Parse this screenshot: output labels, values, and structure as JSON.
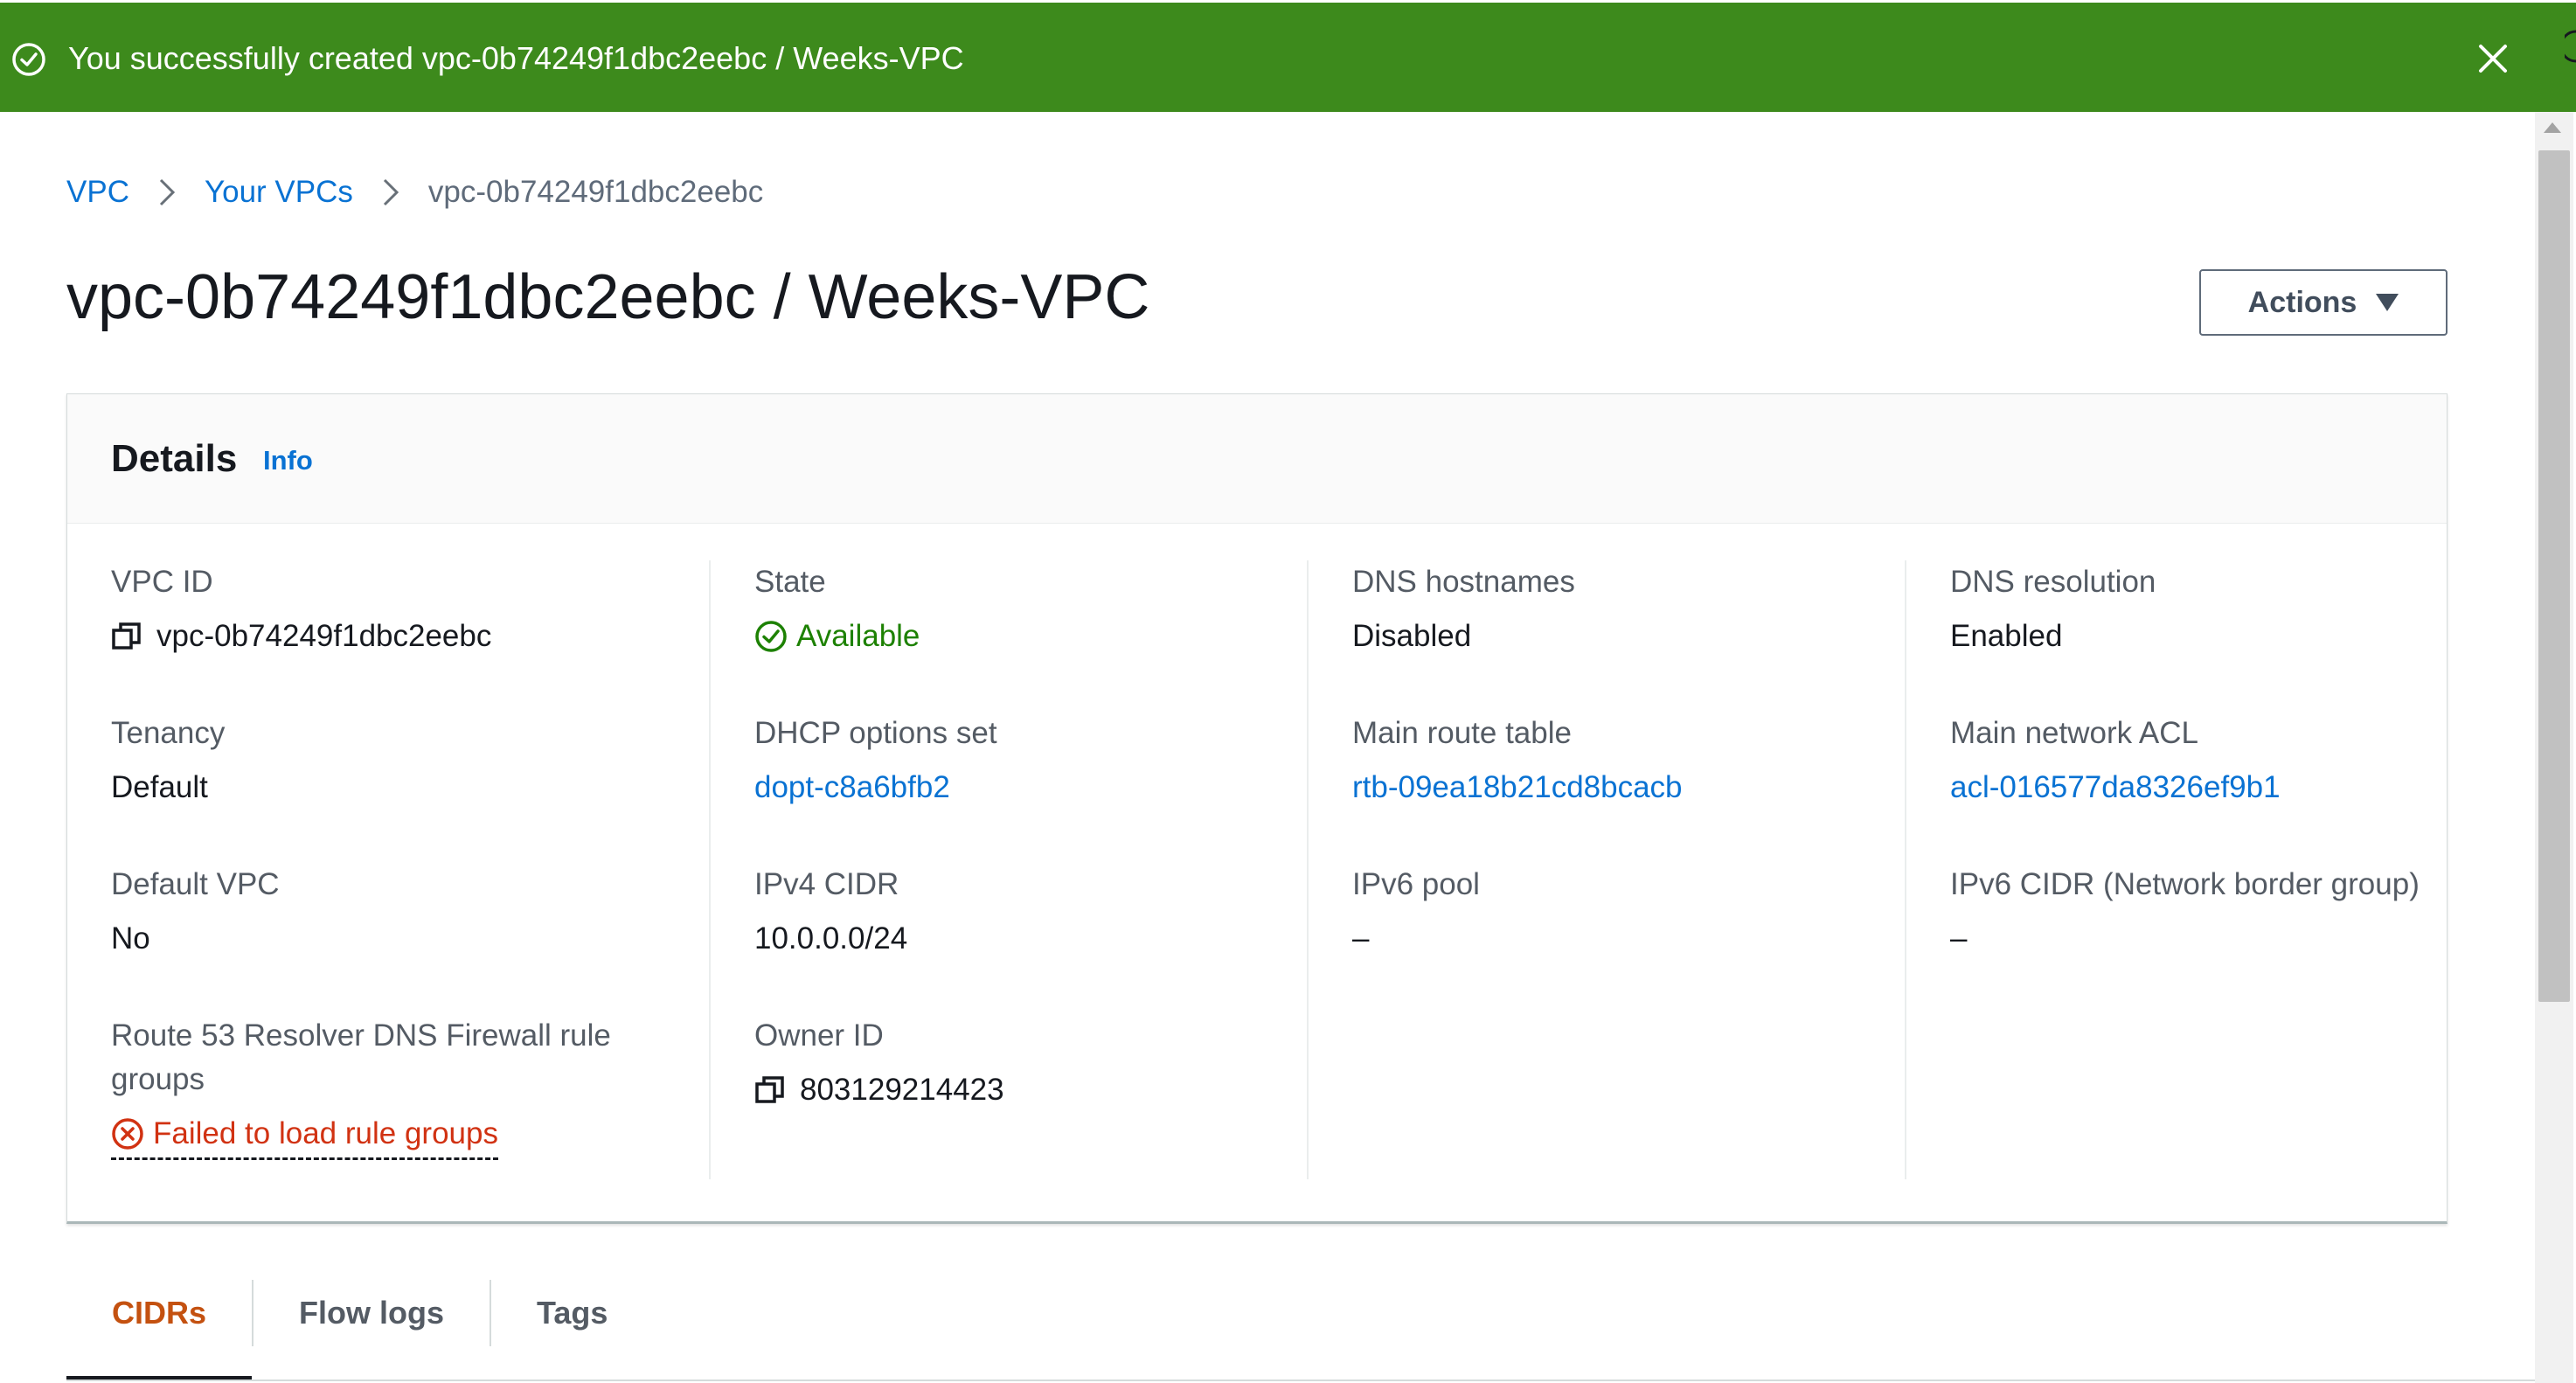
{
  "banner": {
    "message": "You successfully created vpc-0b74249f1dbc2eebc / Weeks-VPC",
    "bg_color": "#3d8a1c",
    "icons": [
      "check-circle-icon",
      "close-icon"
    ]
  },
  "breadcrumb": {
    "items": [
      "VPC",
      "Your VPCs"
    ],
    "current": "vpc-0b74249f1dbc2eebc"
  },
  "page": {
    "title": "vpc-0b74249f1dbc2eebc / Weeks-VPC",
    "actions_label": "Actions"
  },
  "details": {
    "title": "Details",
    "info_label": "Info",
    "vpc_id": {
      "label": "VPC ID",
      "value": "vpc-0b74249f1dbc2eebc"
    },
    "state": {
      "label": "State",
      "value": "Available"
    },
    "dns_hostnames": {
      "label": "DNS hostnames",
      "value": "Disabled"
    },
    "dns_resolution": {
      "label": "DNS resolution",
      "value": "Enabled"
    },
    "tenancy": {
      "label": "Tenancy",
      "value": "Default"
    },
    "dhcp_options": {
      "label": "DHCP options set",
      "value": "dopt-c8a6bfb2"
    },
    "main_route_table": {
      "label": "Main route table",
      "value": "rtb-09ea18b21cd8bcacb"
    },
    "main_network_acl": {
      "label": "Main network ACL",
      "value": "acl-016577da8326ef9b1"
    },
    "default_vpc": {
      "label": "Default VPC",
      "value": "No"
    },
    "ipv4_cidr": {
      "label": "IPv4 CIDR",
      "value": "10.0.0.0/24"
    },
    "ipv6_pool": {
      "label": "IPv6 pool",
      "value": "–"
    },
    "ipv6_cidr": {
      "label": "IPv6 CIDR (Network border group)",
      "value": "–"
    },
    "route53": {
      "label": "Route 53 Resolver DNS Firewall rule groups",
      "value": "Failed to load rule groups"
    },
    "owner_id": {
      "label": "Owner ID",
      "value": "803129214423"
    }
  },
  "tabs": [
    "CIDRs",
    "Flow logs",
    "Tags"
  ],
  "colors": {
    "link": "#0972d3",
    "success": "#1d8102",
    "error": "#d13212",
    "active_tab": "#c45110"
  }
}
